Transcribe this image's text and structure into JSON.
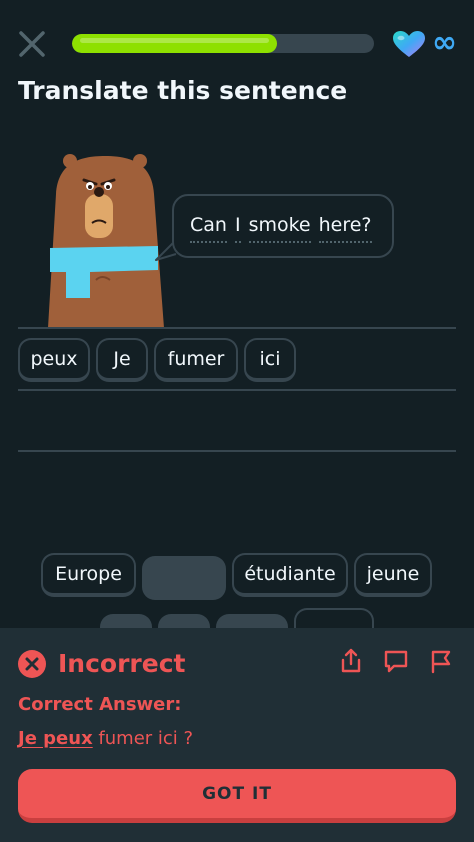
{
  "header": {
    "close_icon": "close-icon",
    "progress": 0.68,
    "progress_color": "#8ee000",
    "hearts_icon": "heart-icon",
    "hearts_value": "∞"
  },
  "challenge": {
    "title": "Translate this sentence",
    "prompt_words": [
      "Can",
      "I",
      "smoke",
      "here?"
    ]
  },
  "answer_tiles": [
    "peux",
    "Je",
    "fumer",
    "ici"
  ],
  "word_bank": {
    "row1": [
      "Europe",
      "",
      "étudiante",
      "jeune"
    ]
  },
  "feedback": {
    "status": "Incorrect",
    "correct_label": "Correct Answer:",
    "answer_highlight": "Je peux",
    "answer_rest": " fumer ici ?",
    "button": "GOT IT",
    "color": "#ee5555"
  }
}
